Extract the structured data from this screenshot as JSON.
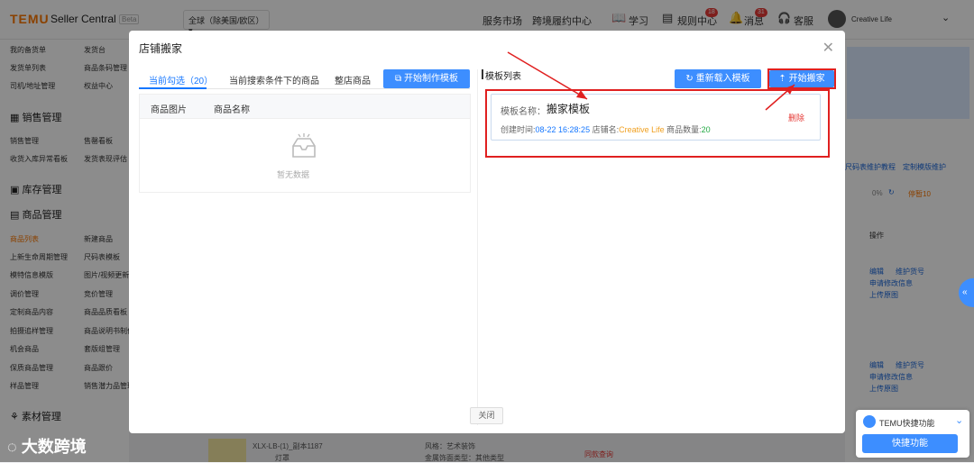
{
  "header": {
    "logo": "TEMU",
    "logo_sub": "Seller Central",
    "beta": "Beta",
    "region": "全球（除美国/欧区）",
    "nav": [
      "服务市场",
      "跨境履约中心"
    ],
    "learn": "学习",
    "rules": "规则中心",
    "rules_badge": "18",
    "messages": "消息",
    "messages_badge": "31",
    "service": "客服",
    "shop": "Creative Life"
  },
  "sidebar": {
    "rows": [
      [
        "我的备货单",
        "发货台"
      ],
      [
        "发货单列表",
        "商品条码管理"
      ],
      [
        "司机/地址管理",
        "权益中心"
      ]
    ],
    "sales_title": "销售管理",
    "sales_rows": [
      [
        "销售管理",
        "售罄看板"
      ],
      [
        "收货入库异常看板",
        "发货表现评估"
      ]
    ],
    "stock_title": "库存管理",
    "product_title": "商品管理",
    "product_rows": [
      [
        "商品列表",
        "新建商品"
      ],
      [
        "上新生命周期管理",
        "尺码表模板"
      ],
      [
        "模特信息模版",
        "图片/视频更新"
      ],
      [
        "调价管理",
        "竞价管理"
      ],
      [
        "定制商品内容",
        "商品品质看板"
      ],
      [
        "拍摄追样管理",
        "商品说明书制作"
      ],
      [
        "机会商品",
        "套版组管理"
      ],
      [
        "保质商品管理",
        "商品跟价"
      ],
      [
        "样品管理",
        "销售潜力品管理"
      ]
    ],
    "material_title": "素材管理"
  },
  "background_right": {
    "links": [
      "尺码表维护教程",
      "定制模版维护"
    ],
    "progress": "0%",
    "pause": "停暂10",
    "op_header": "操作",
    "ops": [
      [
        "编辑",
        "维护货号"
      ],
      [
        "申请修改信息"
      ],
      [
        "上传原图"
      ]
    ],
    "ops2": [
      [
        "编辑",
        "维护货号"
      ],
      [
        "申请修改信息"
      ],
      [
        "上传原图"
      ]
    ]
  },
  "background_bottom": {
    "product": "XLX-LB-(1)_副本1187",
    "category": "灯罩",
    "style": "风格：艺术装饰",
    "material": "金属饰面类型：其他类型",
    "link": "同款查询"
  },
  "modal": {
    "title": "店铺搬家",
    "tabs": [
      "当前勾选（20）",
      "当前搜索条件下的商品",
      "整店商品"
    ],
    "make_template_btn": "开始制作模板",
    "table_headers": [
      "商品图片",
      "商品名称"
    ],
    "empty_text": "暂无数据",
    "template_list_label": "模板列表",
    "reload_btn": "重新载入模板",
    "start_move_btn": "开始搬家",
    "template_card": {
      "name_label": "模板名称：",
      "name": "搬家模板",
      "created_label": "创建时间:",
      "created": "08-22 16:28:25",
      "shop_label": "店铺名:",
      "shop": "Creative Life",
      "count_label": "商品数量:",
      "count": "20",
      "delete": "删除"
    },
    "close_btn": "关闭"
  },
  "watermark": "大数跨境",
  "float_panel": {
    "title": "TEMU快捷功能",
    "btn": "快捷功能"
  },
  "colors": {
    "accent": "#3d8eff",
    "temu_orange": "#fb7701",
    "highlight_red": "#e02020",
    "shop_name": "#f0a020",
    "count_green": "#22aa44"
  }
}
